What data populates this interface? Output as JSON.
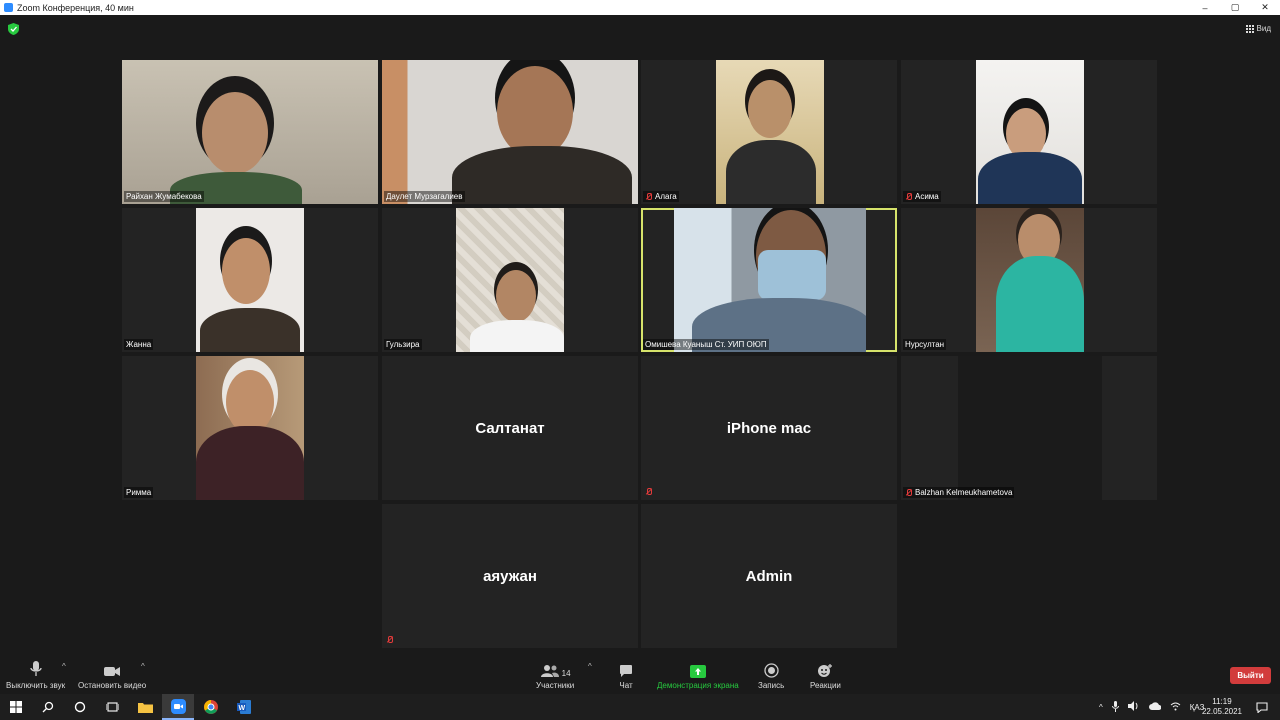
{
  "window": {
    "title": "Zoom Конференция, 40 мин",
    "controls": [
      "–",
      "▢",
      "✕"
    ]
  },
  "view_button": {
    "label": "Вид"
  },
  "participants": [
    {
      "name": "Райхан Жумабекова",
      "muted": false,
      "video": true,
      "active": false
    },
    {
      "name": "Даулет Мурзагалиев",
      "muted": false,
      "video": true,
      "active": false
    },
    {
      "name": "Алага",
      "muted": true,
      "video": true,
      "active": false
    },
    {
      "name": "Асима",
      "muted": true,
      "video": true,
      "active": false
    },
    {
      "name": "Жанна",
      "muted": false,
      "video": true,
      "active": false
    },
    {
      "name": "Гульзира",
      "muted": false,
      "video": true,
      "active": false
    },
    {
      "name": "Омишева Куаныш Ст. УИП ОЮП",
      "muted": false,
      "video": true,
      "active": true
    },
    {
      "name": "Нурсултан",
      "muted": false,
      "video": true,
      "active": false
    },
    {
      "name": "Римма",
      "muted": false,
      "video": true,
      "active": false
    },
    {
      "name": "Салтанат",
      "muted": false,
      "video": false,
      "active": false
    },
    {
      "name": "iPhone mac",
      "muted": true,
      "video": false,
      "active": false
    },
    {
      "name": "Balzhan Kelmeukhametova",
      "muted": true,
      "video": true,
      "active": false
    },
    {
      "name": "аяужан",
      "muted": true,
      "video": false,
      "active": false
    },
    {
      "name": "Admin",
      "muted": false,
      "video": false,
      "active": false
    }
  ],
  "toolbar": {
    "mute_label": "Выключить звук",
    "video_label": "Остановить видео",
    "participants_label": "Участники",
    "participants_count": "14",
    "chat_label": "Чат",
    "share_label": "Демонстрация экрана",
    "record_label": "Запись",
    "reactions_label": "Реакции",
    "leave_label": "Выйти"
  },
  "taskbar": {
    "language": "ҚАЗ",
    "time": "11:19",
    "date": "22.05.2021"
  },
  "colors": {
    "background": "#1a1a1a",
    "tile": "#232323",
    "active_speaker_border": "#d6e36b",
    "share_green": "#27c93f",
    "leave_red": "#d23c3c",
    "muted_red": "#e23b3b"
  }
}
